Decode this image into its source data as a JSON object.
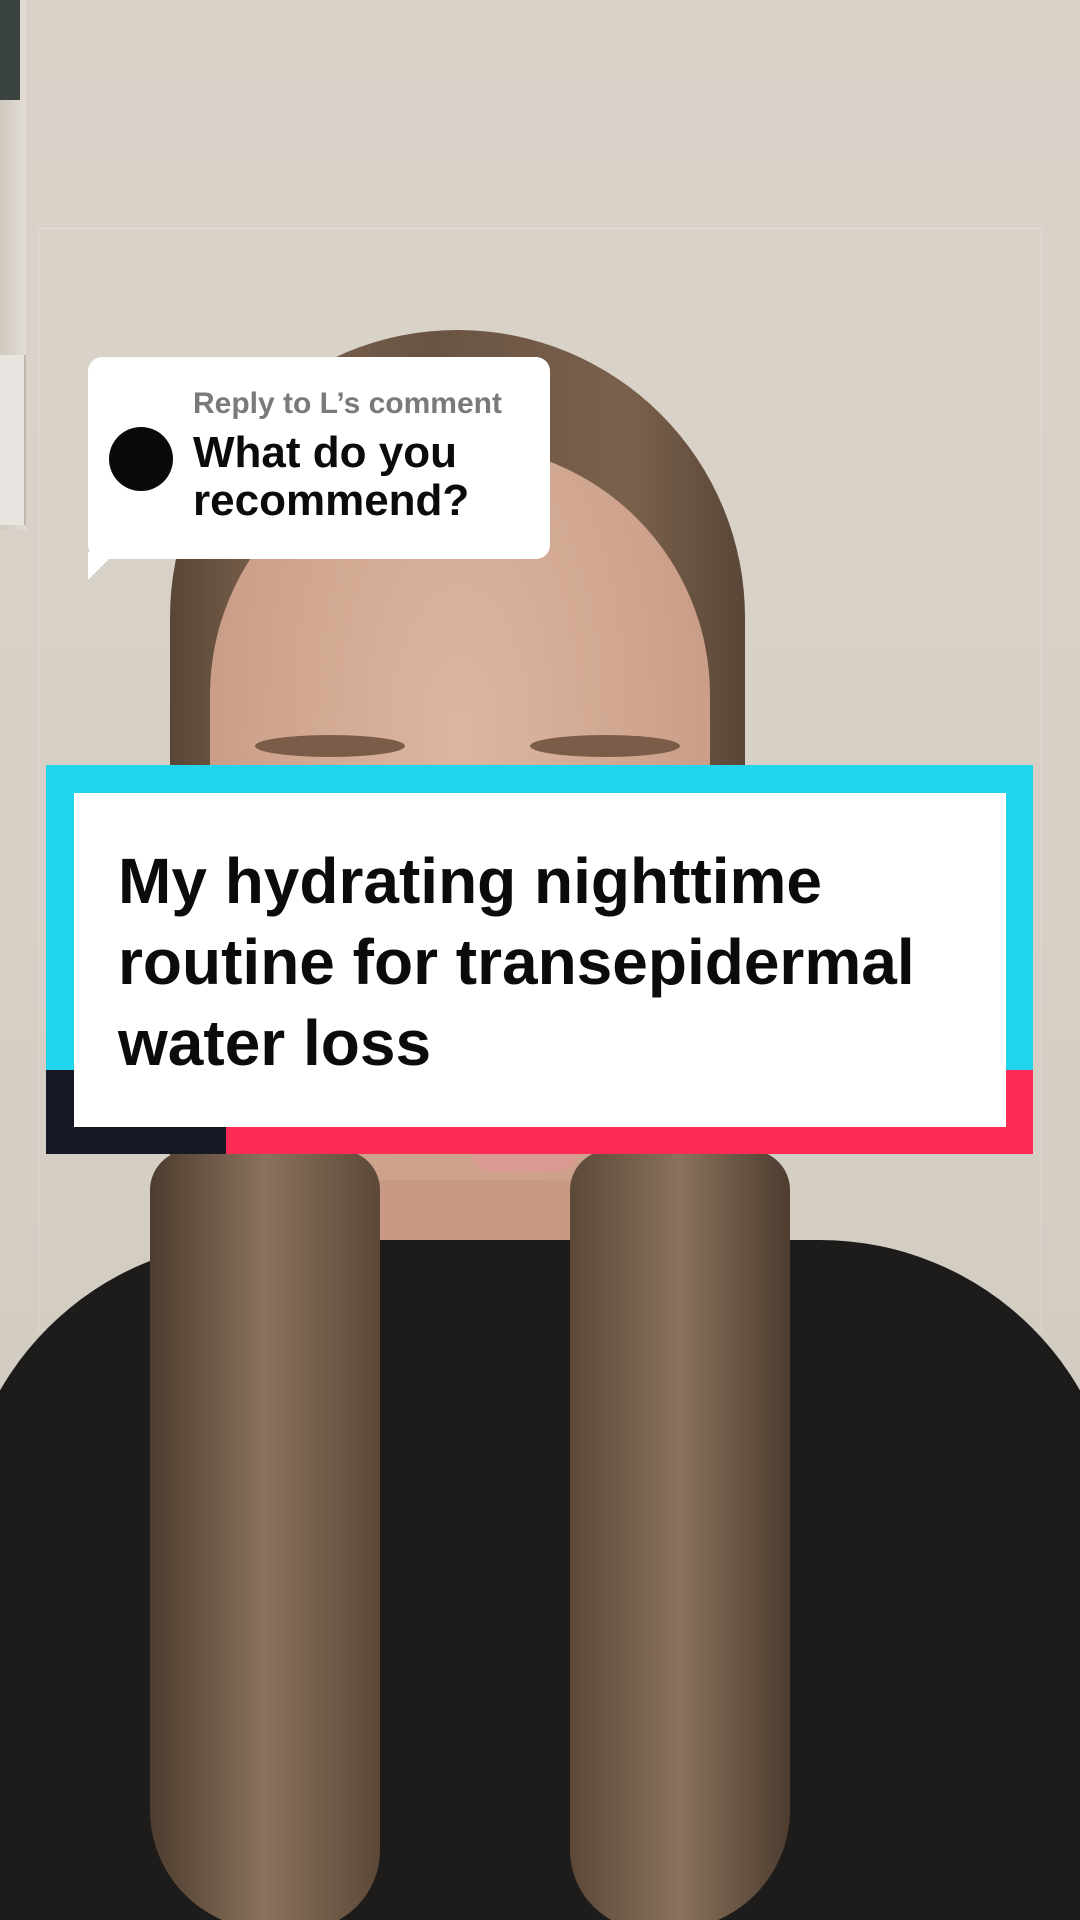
{
  "reply": {
    "label": "Reply to L’s comment",
    "comment": "What do you recommend?"
  },
  "title_card": {
    "text": "My hydrating nighttime routine for transepidermal water loss"
  },
  "colors": {
    "card_cyan": "#20d5ec",
    "card_red": "#fe2c55",
    "card_dark": "#161823",
    "card_white": "#ffffff"
  }
}
